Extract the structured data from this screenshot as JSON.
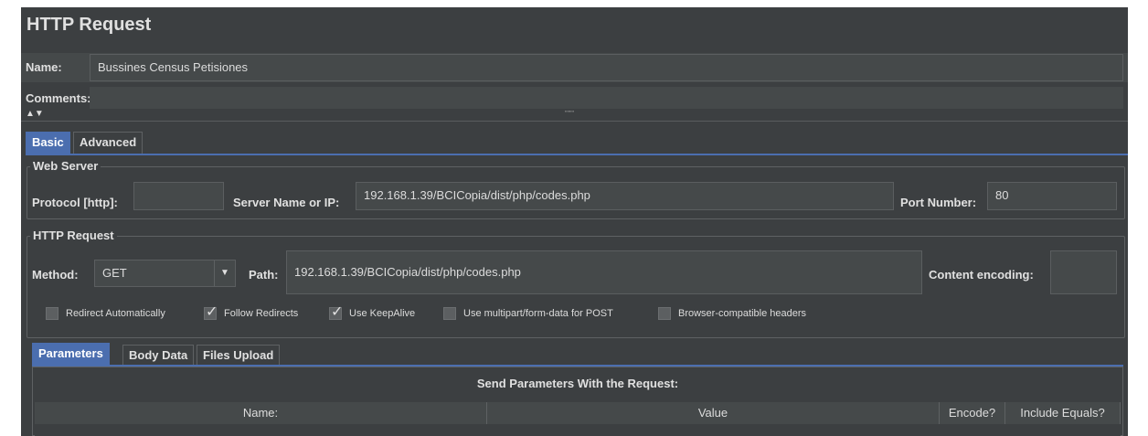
{
  "title": "HTTP Request",
  "name_label": "Name:",
  "name_value": "Bussines Census Petisiones",
  "comments_label": "Comments:",
  "collapse_arrows": "▲▼",
  "splitter_grip": "\"\"\"\"",
  "tabs_top": [
    {
      "label": "Basic",
      "active": true
    },
    {
      "label": "Advanced",
      "active": false
    }
  ],
  "web_server": {
    "title": "Web Server",
    "protocol_label": "Protocol [http]:",
    "protocol_value": "",
    "server_label": "Server Name or IP:",
    "server_value": "192.168.1.39/BCICopia/dist/php/codes.php",
    "port_label": "Port Number:",
    "port_value": "80"
  },
  "http_request": {
    "title": "HTTP Request",
    "method_label": "Method:",
    "method_value": "GET",
    "path_label": "Path:",
    "path_value": "192.168.1.39/BCICopia/dist/php/codes.php",
    "encoding_label": "Content encoding:",
    "encoding_value": ""
  },
  "checkboxes": [
    {
      "label": "Redirect Automatically",
      "checked": false
    },
    {
      "label": "Follow Redirects",
      "checked": true
    },
    {
      "label": "Use KeepAlive",
      "checked": true
    },
    {
      "label": "Use multipart/form-data for POST",
      "checked": false
    },
    {
      "label": "Browser-compatible headers",
      "checked": false
    }
  ],
  "tabs_bottom": [
    {
      "label": "Parameters",
      "active": true
    },
    {
      "label": "Body Data",
      "active": false
    },
    {
      "label": "Files Upload",
      "active": false
    }
  ],
  "params_title": "Send Parameters With the Request:",
  "columns": [
    "Name:",
    "Value",
    "Encode?",
    "Include Equals?"
  ],
  "colors": {
    "background": "#3c3f41",
    "field": "#45494a",
    "accent": "#4b6eaf"
  }
}
